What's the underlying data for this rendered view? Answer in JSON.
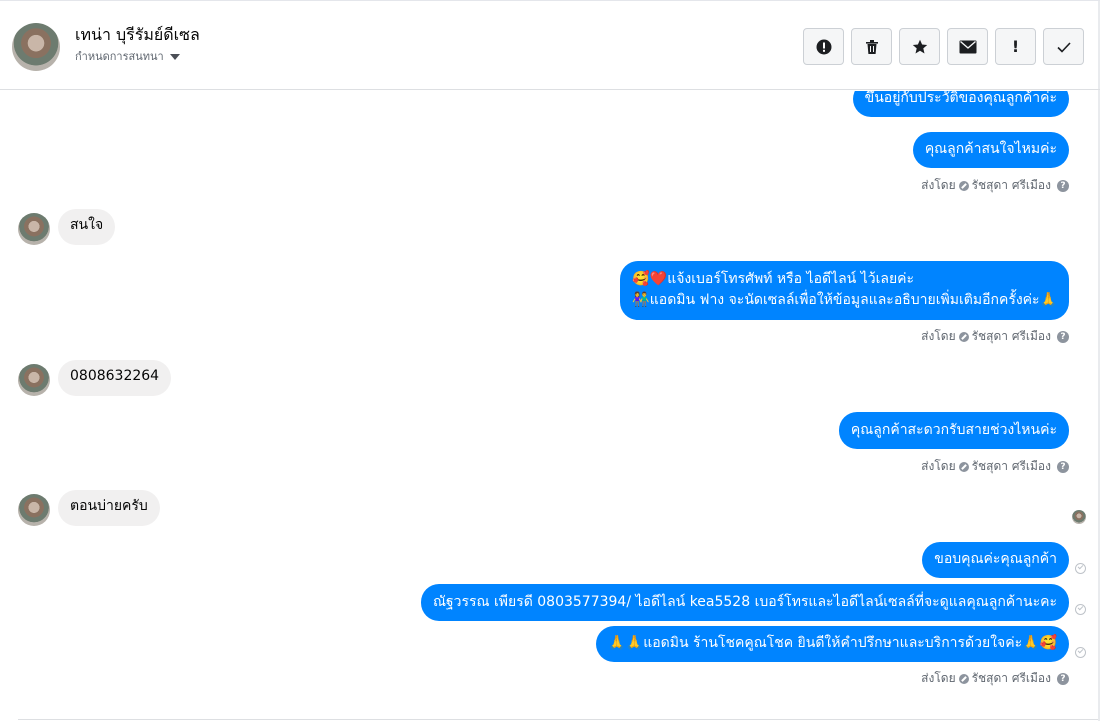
{
  "header": {
    "contact_name": "เทน่า บุรีรัมย์ดีเซล",
    "subtitle": "กำหนดการสนทนา",
    "actions": [
      {
        "name": "report-icon",
        "label": "!"
      },
      {
        "name": "trash-icon",
        "label": ""
      },
      {
        "name": "star-icon",
        "label": ""
      },
      {
        "name": "envelope-icon",
        "label": ""
      },
      {
        "name": "exclamation-icon",
        "label": "!"
      },
      {
        "name": "checkmark-icon",
        "label": "✓"
      }
    ]
  },
  "messages": [
    {
      "id": "m1",
      "direction": "out",
      "lines": [
        "ขึ้นอยู่กับประวัติของคุณลูกค้าค่ะ"
      ]
    },
    {
      "id": "m2",
      "direction": "out",
      "lines": [
        "คุณลูกค้าสนใจไหมค่ะ"
      ]
    },
    {
      "id": "m3",
      "direction": "in",
      "lines": [
        "สนใจ"
      ]
    },
    {
      "id": "m4",
      "direction": "out",
      "lines": [
        "🥰❤️แจ้งเบอร์โทรศัพท์ หรือ ไอดีไลน์  ไว้เลยค่ะ",
        "👫แอดมิน ฟาง จะนัดเซลล์เพื่อให้ข้อมูลและอธิบายเพิ่มเติมอีกครั้งค่ะ🙏"
      ]
    },
    {
      "id": "m5",
      "direction": "in",
      "lines": [
        "0808632264"
      ]
    },
    {
      "id": "m6",
      "direction": "out",
      "lines": [
        "คุณลูกค้าสะดวกรับสายช่วงไหนค่ะ"
      ]
    },
    {
      "id": "m7",
      "direction": "in",
      "lines": [
        "ตอนบ่ายครับ"
      ]
    },
    {
      "id": "m8",
      "direction": "out",
      "lines": [
        "ขอบคุณค่ะคุณลูกค้า"
      ]
    },
    {
      "id": "m9",
      "direction": "out",
      "lines": [
        "ณัฐวรรณ  เพียรดี    0803577394/ ไอดีไลน์ kea5528  เบอร์โทรและไอดีไลน์เซลล์ที่จะดูแลคุณลูกค้านะคะ"
      ]
    },
    {
      "id": "m10",
      "direction": "out",
      "lines": [
        "🙏🙏แอดมิน ร้านโชคคูณโชค ยินดีให้คำปรึกษาและบริการด้วยใจค่ะ🙏🥰"
      ]
    }
  ],
  "sent_by": {
    "prefix": "ส่งโดย",
    "agent": "รัชสุดา ศรีเมือง",
    "help": "?"
  },
  "colors": {
    "outgoing_bubble": "#0084ff",
    "incoming_bubble": "#f1f0f0",
    "meta_text": "#606770"
  }
}
